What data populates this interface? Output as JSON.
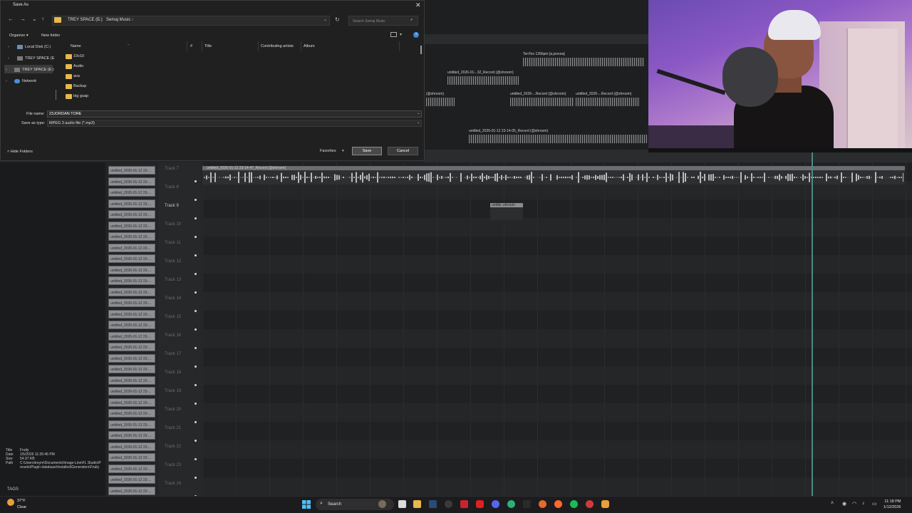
{
  "dialog": {
    "title": "Save As",
    "close_glyph": "✕",
    "nav": {
      "back": "←",
      "forward": "→",
      "dropdown": "⌄",
      "up": "↑"
    },
    "breadcrumb": [
      "TREY SPACE (E:)",
      "Semaj Music"
    ],
    "breadcrumb_sep": "›",
    "search_placeholder": "Search Semaj Music",
    "organize_label": "Organize ▾",
    "new_folder_label": "New folder",
    "nav_pane": [
      {
        "label": "Local Disk (C:)",
        "icon": "drive-icon"
      },
      {
        "label": "TREY SPACE (E",
        "icon": "drive-icon"
      },
      {
        "label": "TREY SPACE (E:)",
        "icon": "drive-icon",
        "selected": true
      },
      {
        "label": "Network",
        "icon": "network-icon"
      }
    ],
    "columns": [
      "Name",
      "#",
      "Title",
      "Contributing artists",
      "Album"
    ],
    "folders": [
      "10x10",
      "Audio",
      "ava",
      "Backup",
      "big guap"
    ],
    "file_name_label": "File name:",
    "file_name_value": "23JORDAN TORE",
    "save_type_label": "Save as type:",
    "save_type_value": "MPEG 3 audio file (*.mp3)",
    "hide_folders_label": "Hide Folders",
    "favorites_label": "Favorites",
    "save_label": "Save",
    "cancel_label": "Cancel"
  },
  "daw": {
    "clip_label": "untitled_2026-01-12 23-...",
    "clip_count": 30,
    "tracks": [
      "Track 7",
      "Track 8",
      "Track 9",
      "Track 10",
      "Track 11",
      "Track 12",
      "Track 13",
      "Track 14",
      "Track 15",
      "Track 16",
      "Track 17",
      "Track 18",
      "Track 19",
      "Track 20",
      "Track 21",
      "Track 22",
      "Track 23",
      "Track 24"
    ],
    "track7_clip_name": "untitled_2026-01-12 23-14-47_Record (@shroom)",
    "small_clip_name": "untitle..shroom",
    "upper_clips": [
      "TenTen 136bpm [a.jsonea]",
      "untitled_2026-01-..32_Record (@shroom)",
      "(@shroom)",
      "untitled_2026-...Record (@shroom)",
      "untitled_2026-...Record (@shroom)",
      "untitled_2026-01-12 23-14-05_Record (@shroom)"
    ]
  },
  "info_panel": {
    "rows": [
      {
        "key": "Title",
        "value": "Fruity"
      },
      {
        "key": "Date",
        "value": "1/5/2026 11:35:46 PM"
      },
      {
        "key": "Size",
        "value": "54.97 KB"
      },
      {
        "key": "Path",
        "value": "C:\\Users\\treym\\Documents\\Image-Line\\FL Studio\\Presets\\Plugin database\\Installed\\Generators\\Fruity"
      }
    ],
    "tags_label": "TAGS"
  },
  "taskbar": {
    "weather_temp": "37°F",
    "weather_cond": "Clear",
    "search_label": "Search",
    "time": "11:18 PM",
    "date": "1/12/2026"
  },
  "colors": {
    "folder": "#e7b84a",
    "playhead": "#4c8a86",
    "dialog_bg": "#202020"
  }
}
